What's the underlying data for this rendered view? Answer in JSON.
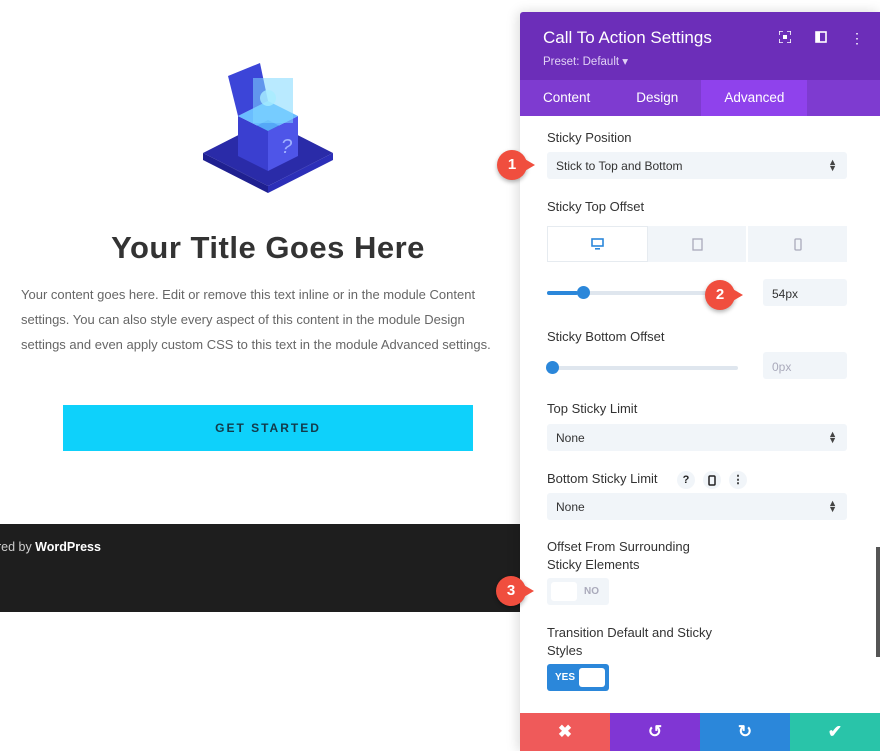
{
  "preview": {
    "title": "Your Title Goes Here",
    "body": "Your content goes here. Edit or remove this text inline or in the module Content settings. You can also style every aspect of this content in the module Design settings and even apply custom CSS to this text in the module Advanced settings.",
    "button_label": "GET STARTED",
    "footer_prefix": "ered by ",
    "footer_brand": "WordPress"
  },
  "panel": {
    "title": "Call To Action Settings",
    "preset": "Preset: Default ▾",
    "tabs": [
      {
        "label": "Content",
        "active": false
      },
      {
        "label": "Design",
        "active": false
      },
      {
        "label": "Advanced",
        "active": true
      }
    ],
    "sticky_position": {
      "label": "Sticky Position",
      "value": "Stick to Top and Bottom"
    },
    "sticky_top_offset": {
      "label": "Sticky Top Offset",
      "value": "54px",
      "level": 0.16
    },
    "sticky_bottom_offset": {
      "label": "Sticky Bottom Offset",
      "value": "0px",
      "level": 0.0
    },
    "top_sticky_limit": {
      "label": "Top Sticky Limit",
      "value": "None"
    },
    "bottom_sticky_limit": {
      "label": "Bottom Sticky Limit",
      "value": "None",
      "help_icon": "?"
    },
    "offset_surrounding": {
      "label_line1": "Offset From Surrounding",
      "label_line2": "Sticky Elements",
      "toggle": "NO"
    },
    "transition": {
      "label_line1": "Transition Default and Sticky",
      "label_line2": "Styles",
      "toggle": "YES"
    }
  },
  "footer_buttons": [
    {
      "name": "discard",
      "glyph": "✖",
      "color": "#ef5a5a"
    },
    {
      "name": "undo",
      "glyph": "↺",
      "color": "#8036d4"
    },
    {
      "name": "redo",
      "glyph": "↻",
      "color": "#2b87da"
    },
    {
      "name": "save",
      "glyph": "✔",
      "color": "#29c4a9"
    }
  ],
  "callouts": [
    "1",
    "2",
    "3"
  ]
}
